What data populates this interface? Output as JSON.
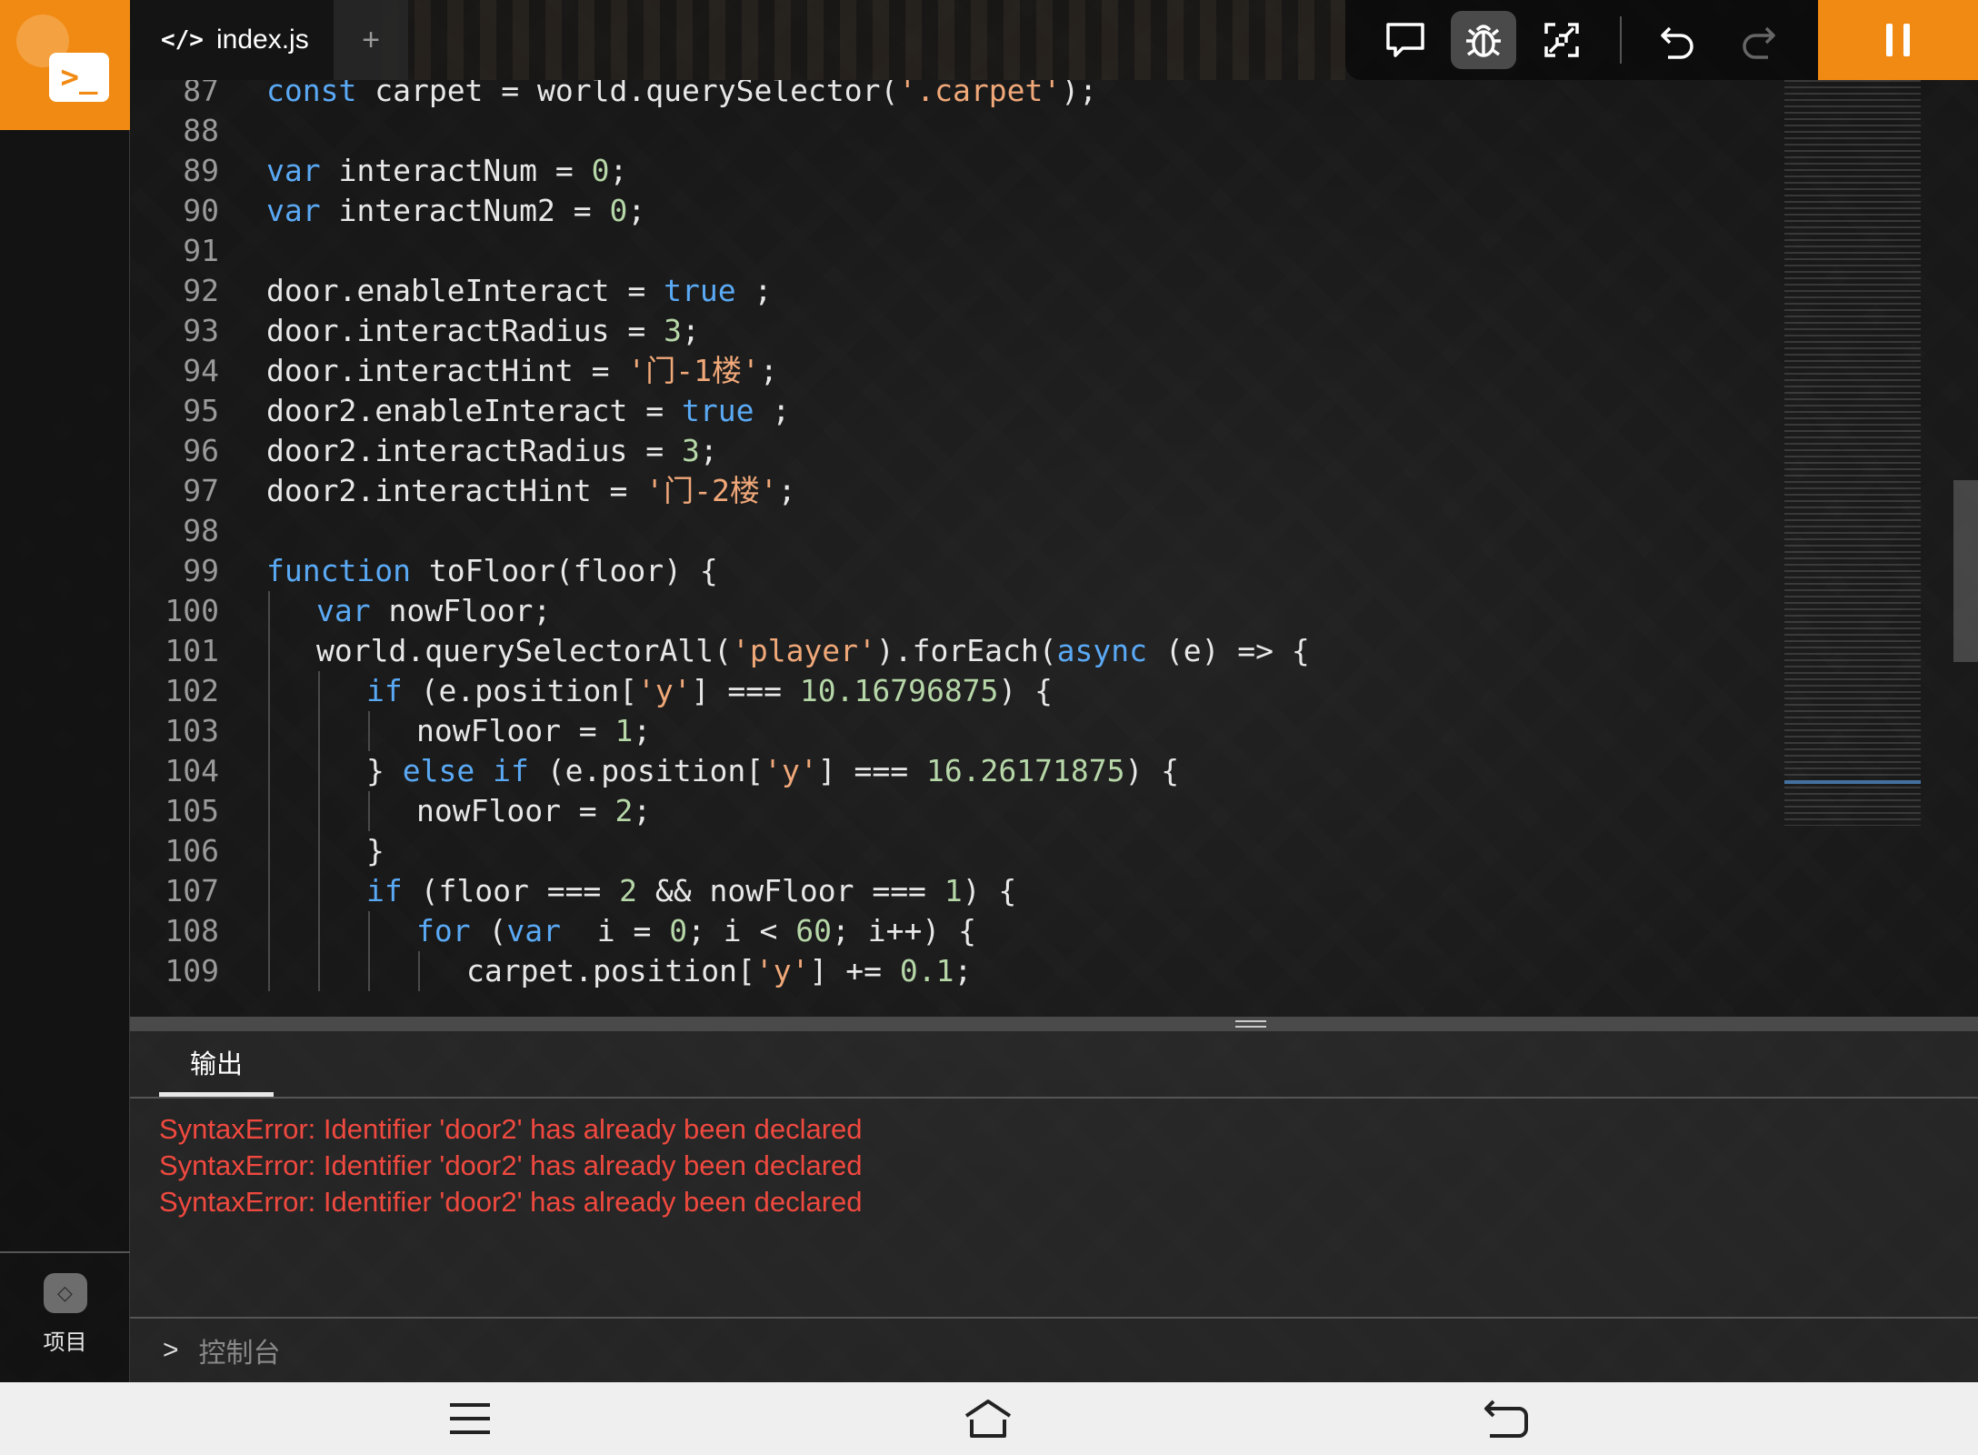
{
  "editor": {
    "tab_title": "index.js",
    "tab_add_label": "+",
    "lines": [
      {
        "n": "87",
        "indent": 0,
        "tokens": [
          [
            "kw",
            "const"
          ],
          [
            "",
            "carpet = world.querySelector("
          ],
          [
            "str",
            "'.carpet'"
          ],
          [
            "",
            ");"
          ]
        ]
      },
      {
        "n": "88",
        "indent": 0,
        "tokens": []
      },
      {
        "n": "89",
        "indent": 0,
        "tokens": [
          [
            "kw",
            "var"
          ],
          [
            "",
            "interactNum = "
          ],
          [
            "num",
            "0"
          ],
          [
            "",
            ";"
          ]
        ]
      },
      {
        "n": "90",
        "indent": 0,
        "tokens": [
          [
            "kw",
            "var"
          ],
          [
            "",
            "interactNum2 = "
          ],
          [
            "num",
            "0"
          ],
          [
            "",
            ";"
          ]
        ]
      },
      {
        "n": "91",
        "indent": 0,
        "tokens": []
      },
      {
        "n": "92",
        "indent": 0,
        "tokens": [
          [
            "",
            "door.enableInteract = "
          ],
          [
            "kw",
            "true"
          ],
          [
            "",
            ";"
          ]
        ]
      },
      {
        "n": "93",
        "indent": 0,
        "tokens": [
          [
            "",
            "door.interactRadius = "
          ],
          [
            "num",
            "3"
          ],
          [
            "",
            ";"
          ]
        ]
      },
      {
        "n": "94",
        "indent": 0,
        "tokens": [
          [
            "",
            "door.interactHint = "
          ],
          [
            "str",
            "'门-1楼'"
          ],
          [
            "",
            ";"
          ]
        ]
      },
      {
        "n": "95",
        "indent": 0,
        "tokens": [
          [
            "",
            "door2.enableInteract = "
          ],
          [
            "kw",
            "true"
          ],
          [
            "",
            ";"
          ]
        ]
      },
      {
        "n": "96",
        "indent": 0,
        "tokens": [
          [
            "",
            "door2.interactRadius = "
          ],
          [
            "num",
            "3"
          ],
          [
            "",
            ";"
          ]
        ]
      },
      {
        "n": "97",
        "indent": 0,
        "tokens": [
          [
            "",
            "door2.interactHint = "
          ],
          [
            "str",
            "'门-2楼'"
          ],
          [
            "",
            ";"
          ]
        ]
      },
      {
        "n": "98",
        "indent": 0,
        "tokens": []
      },
      {
        "n": "99",
        "indent": 0,
        "tokens": [
          [
            "kw",
            "function"
          ],
          [
            "",
            "toFloor(floor) {"
          ]
        ]
      },
      {
        "n": "100",
        "indent": 1,
        "tokens": [
          [
            "kw",
            "var"
          ],
          [
            "",
            "nowFloor;"
          ]
        ]
      },
      {
        "n": "101",
        "indent": 1,
        "tokens": [
          [
            "",
            "world.querySelectorAll("
          ],
          [
            "str",
            "'player'"
          ],
          [
            "",
            ").forEach("
          ],
          [
            "kw",
            "async"
          ],
          [
            "",
            "(e) => {"
          ]
        ]
      },
      {
        "n": "102",
        "indent": 2,
        "tokens": [
          [
            "kw",
            "if"
          ],
          [
            "",
            "(e.position["
          ],
          [
            "str",
            "'y'"
          ],
          [
            "",
            "] === "
          ],
          [
            "num",
            "10.16796875"
          ],
          [
            "",
            ") {"
          ]
        ]
      },
      {
        "n": "103",
        "indent": 3,
        "tokens": [
          [
            "",
            "nowFloor = "
          ],
          [
            "num",
            "1"
          ],
          [
            "",
            ";"
          ]
        ]
      },
      {
        "n": "104",
        "indent": 2,
        "tokens": [
          [
            "",
            "} "
          ],
          [
            "kw",
            "else if"
          ],
          [
            "",
            "(e.position["
          ],
          [
            "str",
            "'y'"
          ],
          [
            "",
            "] === "
          ],
          [
            "num",
            "16.26171875"
          ],
          [
            "",
            ") {"
          ]
        ]
      },
      {
        "n": "105",
        "indent": 3,
        "tokens": [
          [
            "",
            "nowFloor = "
          ],
          [
            "num",
            "2"
          ],
          [
            "",
            ";"
          ]
        ]
      },
      {
        "n": "106",
        "indent": 2,
        "tokens": [
          [
            "",
            "}"
          ]
        ]
      },
      {
        "n": "107",
        "indent": 2,
        "tokens": [
          [
            "kw",
            "if"
          ],
          [
            "",
            "(floor === "
          ],
          [
            "num",
            "2"
          ],
          [
            "",
            " && nowFloor === "
          ],
          [
            "num",
            "1"
          ],
          [
            "",
            ") {"
          ]
        ]
      },
      {
        "n": "108",
        "indent": 3,
        "tokens": [
          [
            "kw",
            "for"
          ],
          [
            "",
            "("
          ],
          [
            "kw",
            "var"
          ],
          [
            "",
            " i = "
          ],
          [
            "num",
            "0"
          ],
          [
            "",
            "; i < "
          ],
          [
            "num",
            "60"
          ],
          [
            "",
            "; i++) {"
          ]
        ]
      },
      {
        "n": "109",
        "indent": 4,
        "tokens": [
          [
            "",
            "carpet.position["
          ],
          [
            "str",
            "'y'"
          ],
          [
            "",
            "] += "
          ],
          [
            "num",
            "0.1"
          ],
          [
            "",
            ";"
          ]
        ]
      }
    ]
  },
  "toolbar": {
    "icons": [
      "chat-icon",
      "bug-icon",
      "shrink-icon",
      "undo-icon",
      "redo-icon"
    ],
    "active": "bug-icon",
    "pause_icon": "pause-icon"
  },
  "sidebar": {
    "logo_glyph": ">_",
    "project_label": "项目"
  },
  "output": {
    "tab_label": "输出",
    "errors": [
      "SyntaxError: Identifier 'door2' has already been declared",
      "SyntaxError: Identifier 'door2' has already been declared",
      "SyntaxError: Identifier 'door2' has already been declared"
    ],
    "console_label": "控制台",
    "console_chevron": ">"
  },
  "navbar": {
    "icons": [
      "menu-icon",
      "home-icon",
      "back-icon"
    ]
  },
  "colors": {
    "accent": "#f18a12",
    "keyword": "#5aa9f5",
    "string": "#f0a879",
    "number": "#b6d7a8",
    "error": "#f0493f"
  }
}
